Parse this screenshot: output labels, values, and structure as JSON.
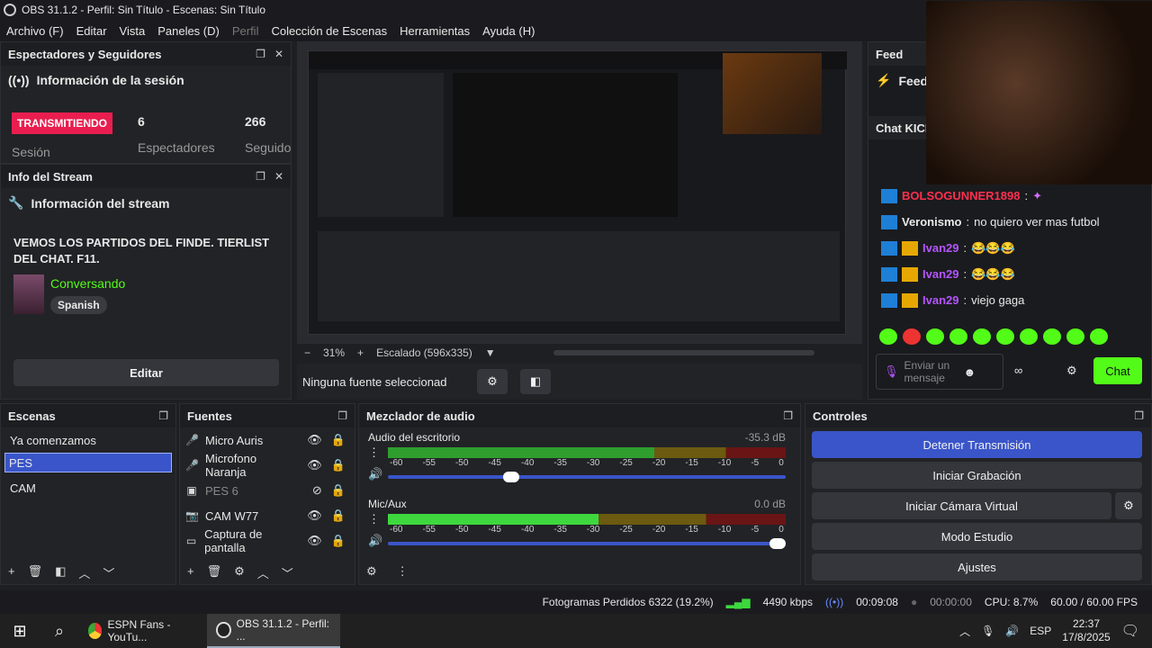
{
  "window": {
    "title": "OBS 31.1.2 - Perfil: Sin Título - Escenas: Sin Título"
  },
  "menu": [
    "Archivo (F)",
    "Editar",
    "Vista",
    "Paneles (D)",
    "Perfil",
    "Colección de Escenas",
    "Herramientas",
    "Ayuda (H)"
  ],
  "viewers": {
    "dock_title": "Espectadores y Seguidores",
    "section": "Información de la sesión",
    "live_label": "TRANSMITIENDO",
    "session_label": "Sesión",
    "viewers_count": "6",
    "viewers_label": "Espectadores",
    "followers_count": "266",
    "followers_label": "Seguido"
  },
  "stream_info": {
    "dock_title": "Info del Stream",
    "section": "Información del stream",
    "title": "VEMOS LOS PARTIDOS DEL FINDE. TIERLIST DEL CHAT. F11.",
    "category": "Conversando",
    "language": "Spanish",
    "edit_label": "Editar"
  },
  "preview": {
    "zoom": "31%",
    "minus": "−",
    "plus": "+",
    "scaling": "Escalado (596x335)",
    "no_source": "Ninguna fuente seleccionad"
  },
  "feed": {
    "dock_title": "Feed",
    "section": "Feed"
  },
  "chat": {
    "dock_title": "Chat KICK",
    "messages": [
      {
        "user": "BOLSOGUNNER1898",
        "sep": ":",
        "text": "",
        "color": "#ff2f4f"
      },
      {
        "user": "Veronismo",
        "sep": ":",
        "text": "no quiero ver mas futbol",
        "color": "#ffffff"
      },
      {
        "user": "Ivan29",
        "sep": ":",
        "text": "😂😂😂",
        "color": "#b455ff"
      },
      {
        "user": "Ivan29",
        "sep": ":",
        "text": "😂😂😂",
        "color": "#b455ff"
      },
      {
        "user": "Ivan29",
        "sep": ":",
        "text": "viejo gaga",
        "color": "#b455ff"
      }
    ],
    "input_placeholder": "Enviar un mensaje",
    "send_label": "Chat"
  },
  "scenes": {
    "dock_title": "Escenas",
    "items": [
      "Ya comenzamos",
      "PES",
      "CAM"
    ],
    "selected": "PES"
  },
  "sources": {
    "dock_title": "Fuentes",
    "items": [
      "Micro Auris",
      "Microfono Naranja",
      "PES 6",
      "CAM W77",
      "Captura de pantalla"
    ]
  },
  "mixer": {
    "dock_title": "Mezclador de audio",
    "channels": [
      {
        "name": "Audio del escritorio",
        "db": "-35.3 dB",
        "level": 0.67,
        "volume": 0.33
      },
      {
        "name": "Mic/Aux",
        "db": "0.0 dB",
        "level": 0.53,
        "volume": 1.0
      }
    ],
    "scale": [
      "-60",
      "-55",
      "-50",
      "-45",
      "-40",
      "-35",
      "-30",
      "-25",
      "-20",
      "-15",
      "-10",
      "-5",
      "0"
    ]
  },
  "controls": {
    "dock_title": "Controles",
    "stop_stream": "Detener Transmisión",
    "start_record": "Iniciar Grabación",
    "start_virtualcam": "Iniciar Cámara Virtual",
    "studio_mode": "Modo Estudio",
    "settings": "Ajustes"
  },
  "status": {
    "dropped": "Fotogramas Perdidos 6322 (19.2%)",
    "bitrate": "4490 kbps",
    "stream_time": "00:09:08",
    "rec_time": "00:00:00",
    "cpu": "CPU: 8.7%",
    "fps": "60.00 / 60.00 FPS"
  },
  "taskbar": {
    "tasks": [
      "ESPN Fans - YouTu...",
      "OBS 31.1.2 - Perfil: ..."
    ],
    "lang": "ESP",
    "time": "22:37",
    "date": "17/8/2025"
  },
  "colors": {
    "accent": "#3a55c9",
    "live": "#e91e4f",
    "kick_green": "#53fc18"
  }
}
